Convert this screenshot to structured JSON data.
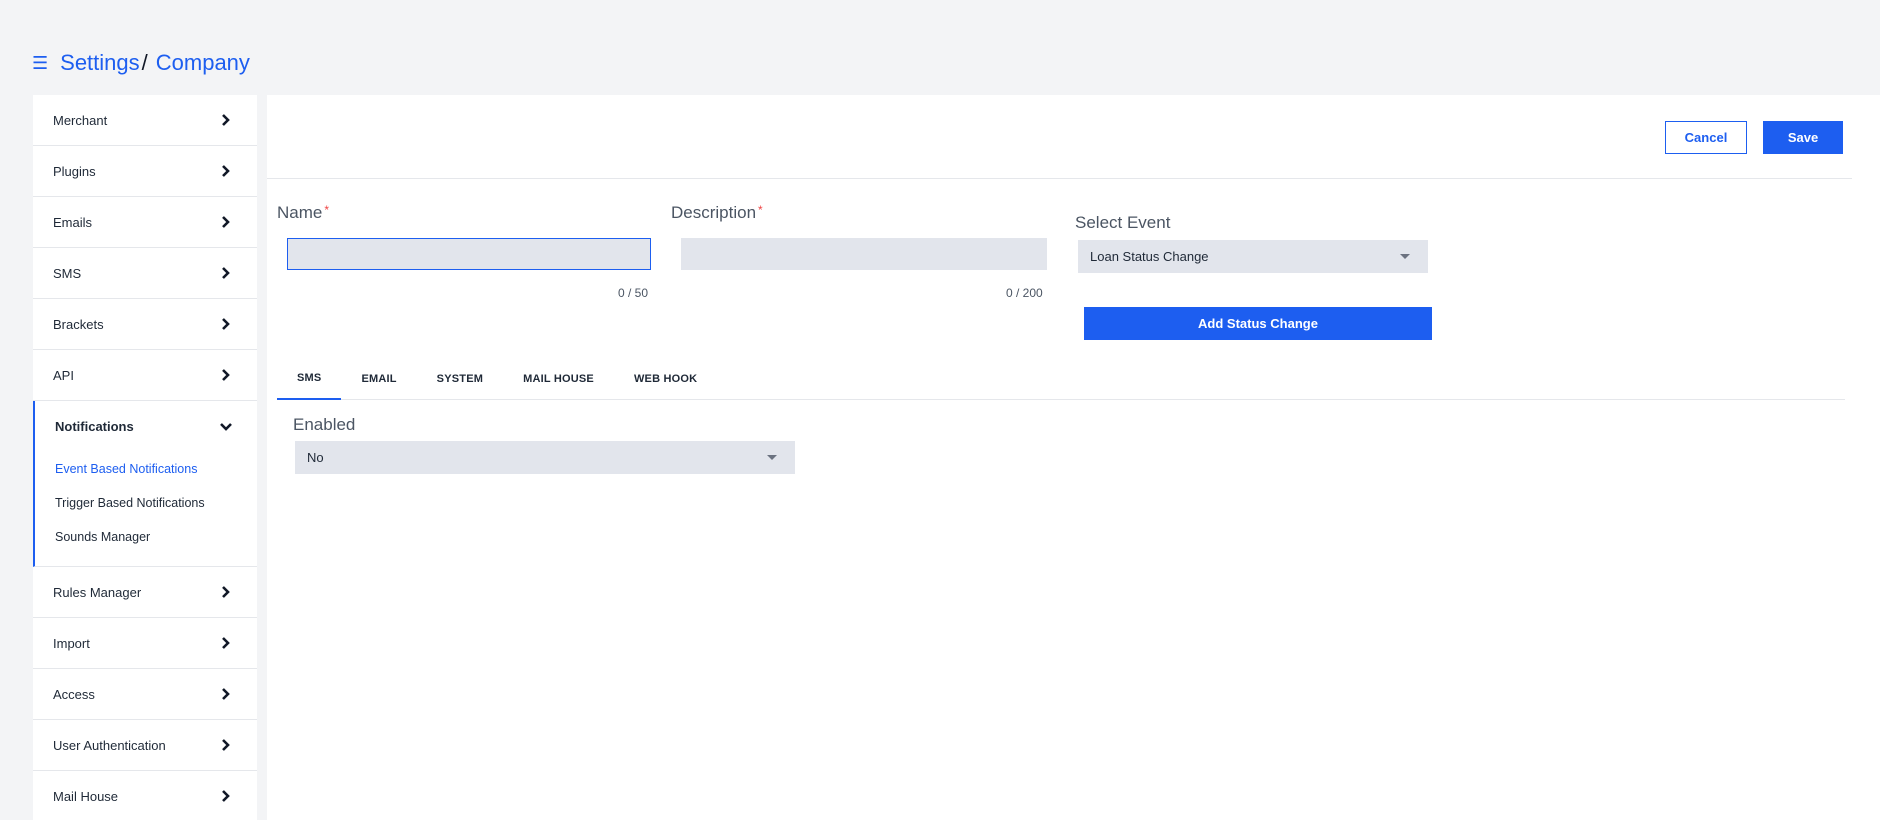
{
  "breadcrumb": {
    "menu_icon": "hamburger-icon",
    "root": "Settings",
    "separator": "/",
    "current": "Company"
  },
  "sidebar": {
    "items_top": [
      {
        "label": "Merchant",
        "icon": "chevron-right-icon"
      },
      {
        "label": "Plugins",
        "icon": "chevron-right-icon"
      },
      {
        "label": "Emails",
        "icon": "chevron-right-icon"
      },
      {
        "label": "SMS",
        "icon": "chevron-right-icon"
      },
      {
        "label": "Brackets",
        "icon": "chevron-right-icon"
      },
      {
        "label": "API",
        "icon": "chevron-right-icon"
      }
    ],
    "expanded": {
      "label": "Notifications",
      "icon": "chevron-down-icon",
      "children": [
        {
          "label": "Event Based Notifications",
          "active": true
        },
        {
          "label": "Trigger Based Notifications",
          "active": false
        },
        {
          "label": "Sounds Manager",
          "active": false
        }
      ]
    },
    "items_bottom": [
      {
        "label": "Rules Manager",
        "icon": "chevron-right-icon"
      },
      {
        "label": "Import",
        "icon": "chevron-right-icon"
      },
      {
        "label": "Access",
        "icon": "chevron-right-icon"
      },
      {
        "label": "User Authentication",
        "icon": "chevron-right-icon"
      },
      {
        "label": "Mail House",
        "icon": "chevron-right-icon"
      }
    ]
  },
  "actions": {
    "cancel_label": "Cancel",
    "save_label": "Save"
  },
  "form": {
    "name": {
      "label": "Name",
      "required_mark": "*",
      "value": "",
      "counter": "0 / 50"
    },
    "description": {
      "label": "Description",
      "required_mark": "*",
      "value": "",
      "counter": "0 / 200"
    },
    "select_event": {
      "label": "Select Event",
      "value": "Loan Status Change"
    },
    "add_status_label": "Add Status Change"
  },
  "tabs": [
    {
      "label": "SMS",
      "active": true
    },
    {
      "label": "EMAIL",
      "active": false
    },
    {
      "label": "SYSTEM",
      "active": false
    },
    {
      "label": "MAIL HOUSE",
      "active": false
    },
    {
      "label": "WEB HOOK",
      "active": false
    }
  ],
  "sms_tab": {
    "enabled_label": "Enabled",
    "enabled_value": "No"
  },
  "colors": {
    "accent": "#1d5ef0",
    "background": "#f3f4f6",
    "input_bg": "#e2e5ec",
    "required": "#ef4444"
  }
}
